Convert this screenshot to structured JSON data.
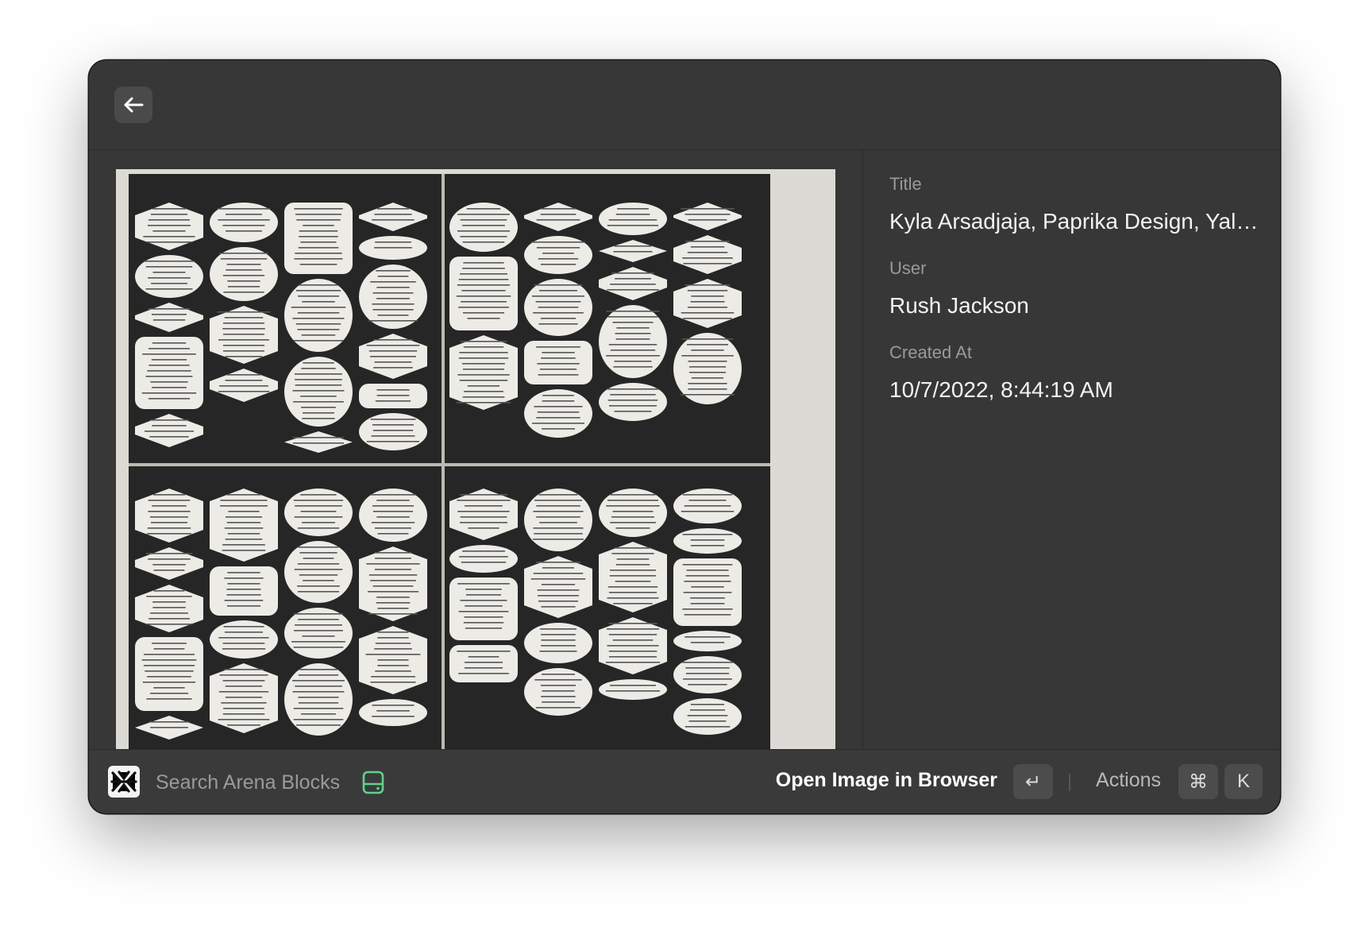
{
  "toolbar": {
    "back_icon": "arrow-left-icon"
  },
  "detail": {
    "image_alt": "Newspaper spread with many oval and hexagonal text bubbles",
    "fields": [
      {
        "label": "Title",
        "value": "Kyla Arsadjaja, Paprika Design, Yale School of Architecture"
      },
      {
        "label": "User",
        "value": "Rush Jackson"
      },
      {
        "label": "Created At",
        "value": "10/7/2022, 8:44:19 AM"
      }
    ]
  },
  "bottom": {
    "search_placeholder": "Search Arena Blocks",
    "primary_action": "Open Image in Browser",
    "enter_key": "↵",
    "actions_label": "Actions",
    "cmd_key": "⌘",
    "k_key": "K",
    "accent": "#5fd28a"
  }
}
